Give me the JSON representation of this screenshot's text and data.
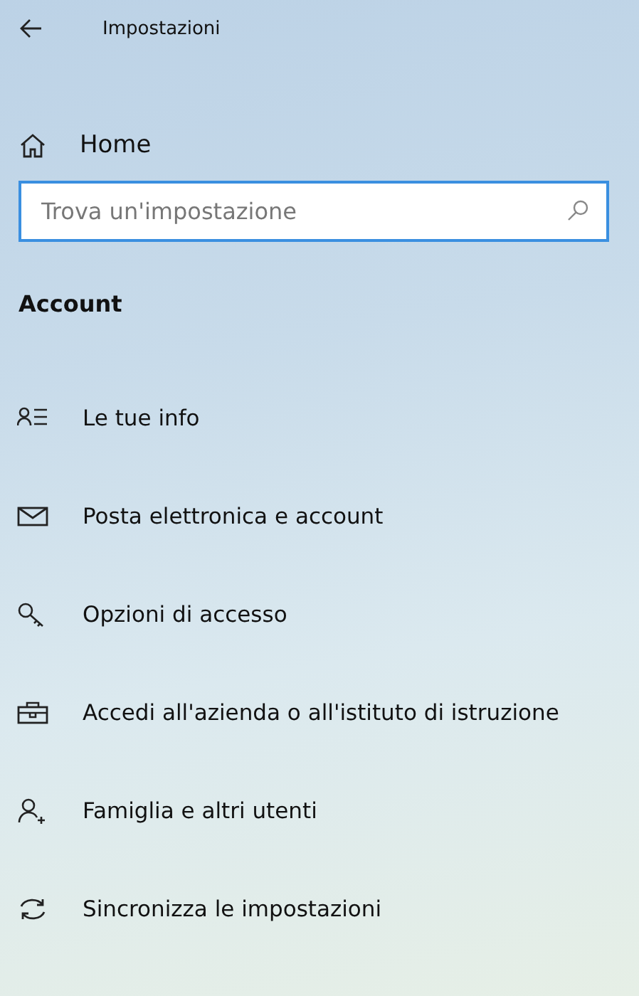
{
  "window": {
    "title": "Impostazioni"
  },
  "home": {
    "label": "Home"
  },
  "search": {
    "placeholder": "Trova un'impostazione"
  },
  "section": {
    "title": "Account"
  },
  "items": [
    {
      "kind": "info",
      "label": "Le tue info"
    },
    {
      "kind": "mail",
      "label": "Posta elettronica e account"
    },
    {
      "kind": "key",
      "label": "Opzioni di accesso"
    },
    {
      "kind": "work",
      "label": "Accedi all'azienda o all'istituto di istruzione"
    },
    {
      "kind": "family",
      "label": "Famiglia e altri utenti"
    },
    {
      "kind": "sync",
      "label": "Sincronizza le impostazioni"
    }
  ]
}
